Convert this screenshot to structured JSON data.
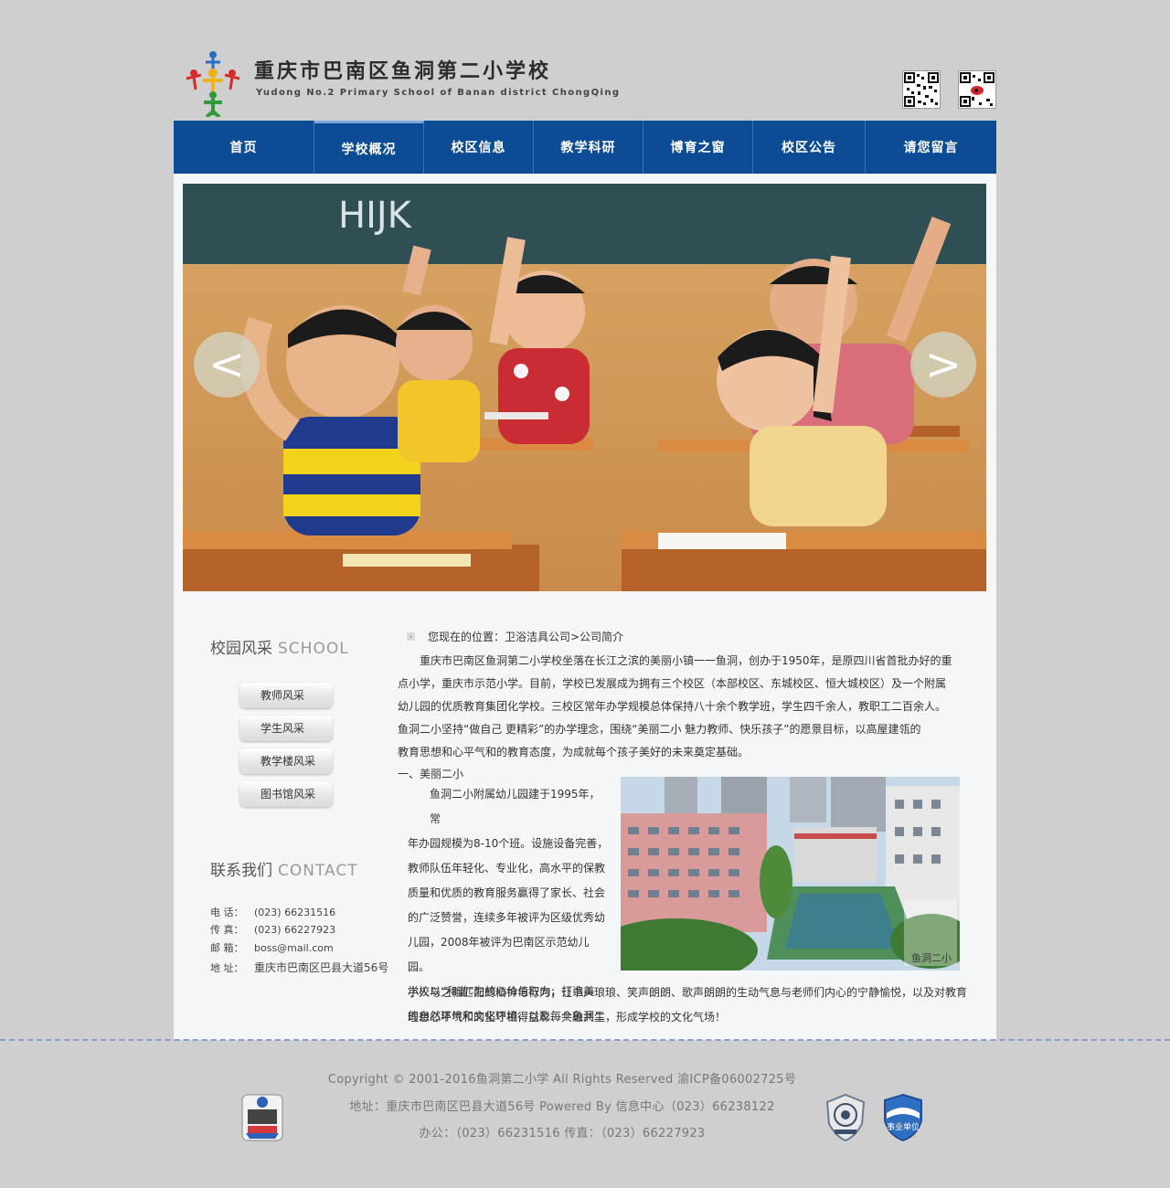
{
  "header": {
    "title_cn": "重庆市巴南区鱼洞第二小学校",
    "title_en": "Yudong No.2 Primary School of Banan district ChongQing",
    "qr_codes": [
      "qr-code-icon",
      "weibo-qr-code-icon"
    ]
  },
  "nav": {
    "items": [
      {
        "label": "首页"
      },
      {
        "label": "学校概况"
      },
      {
        "label": "校区信息"
      },
      {
        "label": "教学科研"
      },
      {
        "label": "博育之窗"
      },
      {
        "label": "校区公告"
      },
      {
        "label": "请您留言"
      }
    ],
    "active_index": 1
  },
  "banner": {
    "prev_label": "<",
    "next_label": ">",
    "image": "children-raising-hands-in-classroom",
    "blackboard_text": "HIJK"
  },
  "sidebar": {
    "school_heading_cn": "校园风采",
    "school_heading_en": "SCHOOL",
    "menu": [
      {
        "label": "教师风采"
      },
      {
        "label": "学生风采"
      },
      {
        "label": "教学楼风采"
      },
      {
        "label": "图书馆风采"
      }
    ],
    "contact_heading_cn": "联系我们",
    "contact_heading_en": "CONTACT",
    "contact": {
      "phone_label": "电  话：",
      "phone": "(023) 66231516",
      "fax_label": "传  真：",
      "fax": "(023) 66227923",
      "email_label": "邮  箱：",
      "email": "boss@mail.com",
      "address_label": "地  址：",
      "address": "重庆市巴南区巴县大道56号"
    }
  },
  "content": {
    "breadcrumb": "您现在的位置：卫浴洁具公司>公司简介",
    "intro": [
      "重庆市巴南区鱼洞第二小学校坐落在长江之滨的美丽小镇一一鱼洞，创办于1950年，是原四川省首批办好的重",
      "点小学，重庆市示范小学。目前，学校已发展成为拥有三个校区（本部校区、东城校区、恒大城校区）及一个附属",
      "幼儿园的优质教育集团化学校。三校区常年办学规模总体保持八十余个教学班，学生四千余人，教职工二百余人。",
      "鱼洞二小坚持“做自己 更精彩”的办学理念，围绕“美丽二小 魅力教师、快乐孩子”的愿景目标，以高屋建瓴的",
      "教育思想和心平气和的教育态度，为成就每个孩子美好的未来奠定基础。"
    ],
    "section_title": "一、美丽二小",
    "section_lines": [
      "鱼洞二小附属幼儿园建于1995年，常",
      "年办园规模为8-10个班。设施设备完善，",
      "教师队伍年轻化、专业化，高水平的保教",
      "质量和优质的教育服务赢得了家长、社会",
      "的广泛赞誉，连续多年被评为区级优秀幼",
      "儿园，2008年被评为巴南区示范幼儿园。",
      "学校以“和谐”为核心价值取向，打造美",
      "的自然环境和文化环境，以及每个鱼洞二"
    ],
    "section_tail": [
      "小人与之相匹配的精神与行为；让书声琅琅、笑声朗朗、歌声朗朗的生动气息与老师们内心的宁静愉悦，以及对教育",
      "理想心平气和的坚守相得益彰、共融共生，形成学校的文化气场！"
    ],
    "photo_watermark": "鱼洞二小"
  },
  "footer": {
    "copyright": "Copyright © 2001-2016鱼洞第二小学 All Rights Reserved 渝ICP备06002725号",
    "address_line": "地址：重庆市巴南区巴县大道56号 Powered By 信息中心（023）66238122",
    "office_line": "办公：（023）66231516 传直：（023）66227923",
    "badges": [
      "police-badge-icon",
      "national-emblem-badge-icon",
      "public-institution-badge-icon"
    ],
    "public_institution_text": "事业单位"
  },
  "colors": {
    "nav_bg": "#0c4c95",
    "page_bg": "#cfcfcf",
    "panel_bg": "#f5f6f8",
    "footer_divider": "#8a9ccc"
  }
}
